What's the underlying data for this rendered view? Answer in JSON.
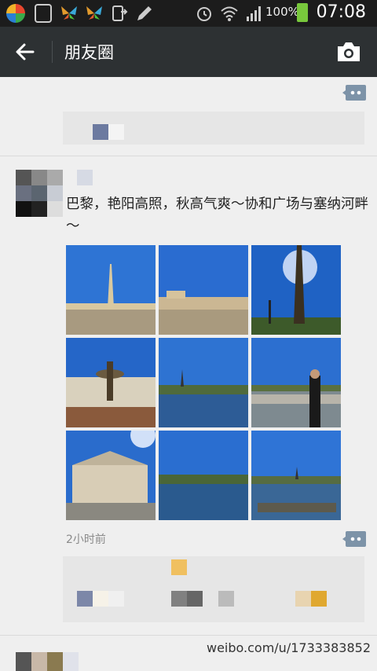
{
  "status_bar": {
    "battery": "100%",
    "time": "07:08"
  },
  "header": {
    "title": "朋友圈",
    "back_icon": "arrow-left-icon",
    "camera_icon": "camera-icon"
  },
  "post": {
    "text": "巴黎，艳阳高照，秋高气爽～协和广场与塞纳河畔～",
    "photo_count": 9,
    "timestamp": "2小时前",
    "comment_icon": "comment-icon"
  },
  "watermark": {
    "text": "weibo.com/u/1733383852"
  },
  "colors": {
    "topbar": "#2d3133",
    "statusbar": "#1c1c1c",
    "background": "#efefef",
    "sky": "#1e63c8"
  }
}
